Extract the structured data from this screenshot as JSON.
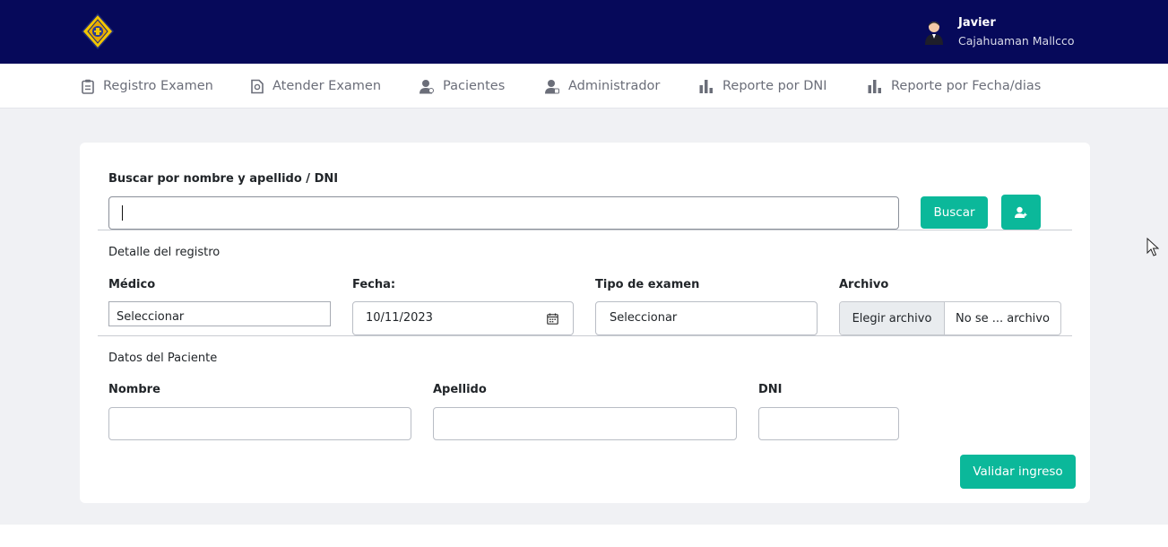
{
  "header": {
    "logo_icon": "shield-logo-icon",
    "user_first_name": "Javier",
    "user_last_name": "Cajahuaman Mallcco",
    "background_color": "#06095a"
  },
  "nav": {
    "items": [
      {
        "label": "Registro Examen",
        "icon": "clipboard-icon"
      },
      {
        "label": "Atender Examen",
        "icon": "document-check-icon"
      },
      {
        "label": "Pacientes",
        "icon": "user-icon"
      },
      {
        "label": "Administrador",
        "icon": "user-admin-icon"
      },
      {
        "label": "Reporte por DNI",
        "icon": "bar-chart-icon"
      },
      {
        "label": "Reporte por Fecha/dias",
        "icon": "bar-chart-icon"
      }
    ]
  },
  "search": {
    "label": "Buscar por nombre y apellido / DNI",
    "value": "",
    "button_label": "Buscar",
    "add_patient_icon": "add-user-icon"
  },
  "registro": {
    "section_title": "Detalle del registro",
    "medico_label": "Médico",
    "medico_value": "Seleccionar",
    "fecha_label": "Fecha:",
    "fecha_value": "10/11/2023",
    "tipo_label": "Tipo de examen",
    "tipo_value": "Seleccionar",
    "archivo_label": "Archivo",
    "archivo_button": "Elegir archivo",
    "archivo_status": "No se ... archivo"
  },
  "paciente": {
    "section_title": "Datos del Paciente",
    "nombre_label": "Nombre",
    "apellido_label": "Apellido",
    "dni_label": "DNI",
    "submit_label": "Validar ingreso"
  },
  "colors": {
    "accent": "#0bb89a",
    "page_background": "#f0f1f4"
  }
}
